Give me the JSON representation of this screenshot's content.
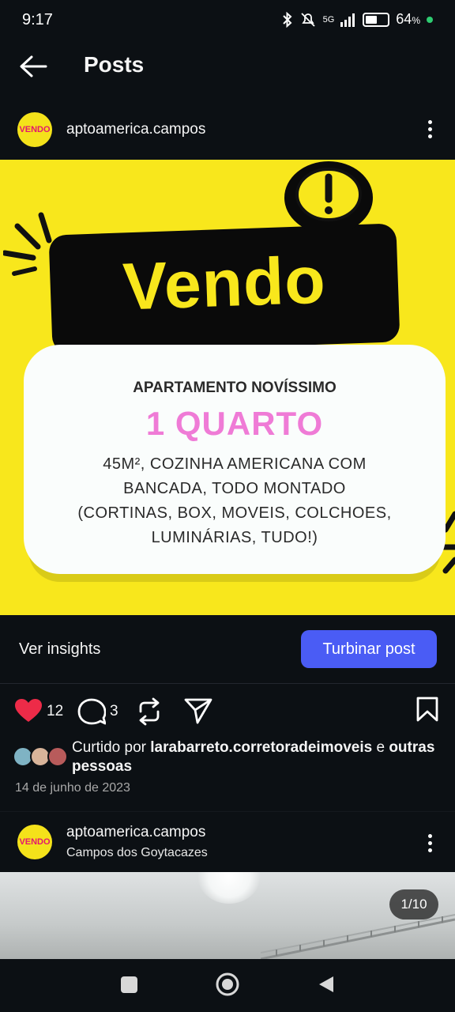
{
  "status_bar": {
    "time": "9:17",
    "network": "5G",
    "battery": "64",
    "battery_unit": "%",
    "battery_level": 0.64
  },
  "header": {
    "title": "Posts"
  },
  "post": {
    "username": "aptoamerica.campos",
    "avatar_text": "VENDO",
    "image": {
      "headline": "Vendo",
      "subheading": "APARTAMENTO NOVÍSSIMO",
      "highlight": "1 QUARTO",
      "body_lines": [
        "45M², COZINHA AMERICANA COM",
        "BANCADA, TODO MONTADO",
        "(CORTINAS, BOX, MOVEIS, COLCHOES,",
        "LUMINÁRIAS, TUDO!)"
      ],
      "colors": {
        "background": "#f8e71c",
        "highlight": "#ef7bd6"
      }
    },
    "insights_label": "Ver insights",
    "boost_label": "Turbinar post",
    "like_count": "12",
    "comment_count": "3",
    "liked_by_prefix": "Curtido por",
    "liked_by_user": "larabarreto.corretoradeimoveis",
    "liked_by_suffix": "e",
    "liked_by_others": "outras pessoas",
    "date": "14 de junho de 2023"
  },
  "next_post": {
    "username": "aptoamerica.campos",
    "avatar_text": "VENDO",
    "location": "Campos dos Goytacazes",
    "page_indicator": "1/10"
  },
  "colors": {
    "accent": "#4a5cf5",
    "like": "#ed2b48",
    "background": "#0c1014"
  },
  "icons": [
    "back-arrow-icon",
    "more-options-icon",
    "heart-icon",
    "comment-icon",
    "repost-icon",
    "share-icon",
    "bookmark-icon",
    "warning-icon",
    "nav-square-icon",
    "nav-home-icon",
    "nav-back-icon"
  ]
}
